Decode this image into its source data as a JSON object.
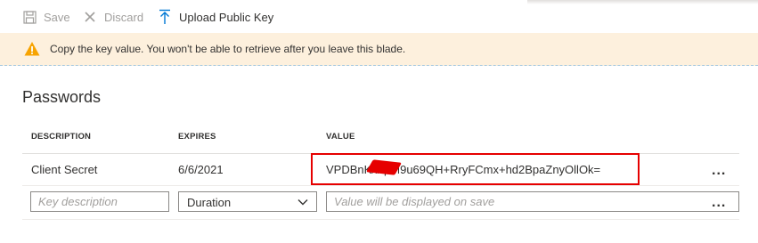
{
  "toolbar": {
    "save_label": "Save",
    "discard_label": "Discard",
    "upload_label": "Upload Public Key",
    "icons": {
      "save": "save-icon",
      "discard": "close-icon",
      "upload": "upload-icon"
    }
  },
  "banner": {
    "message": "Copy the key value. You won't be able to retrieve after you leave this blade.",
    "icon": "warning-icon",
    "color": "#fdf0dd"
  },
  "section": {
    "title": "Passwords"
  },
  "table": {
    "headers": {
      "description": "DESCRIPTION",
      "expires": "EXPIRES",
      "value": "VALUE"
    },
    "rows": [
      {
        "description": "Client Secret",
        "expires": "6/6/2021",
        "value": "VPDBnK/i/          pM9u69QH+RryFCmx+hd2BpaZnyOllOk="
      }
    ],
    "more_label": "..."
  },
  "new_row": {
    "key_placeholder": "Key description",
    "duration_selected": "Duration",
    "value_placeholder": "Value will be displayed on save"
  },
  "colors": {
    "accent": "#0078d4",
    "highlight": "#e60000",
    "warning": "#f7a300"
  }
}
